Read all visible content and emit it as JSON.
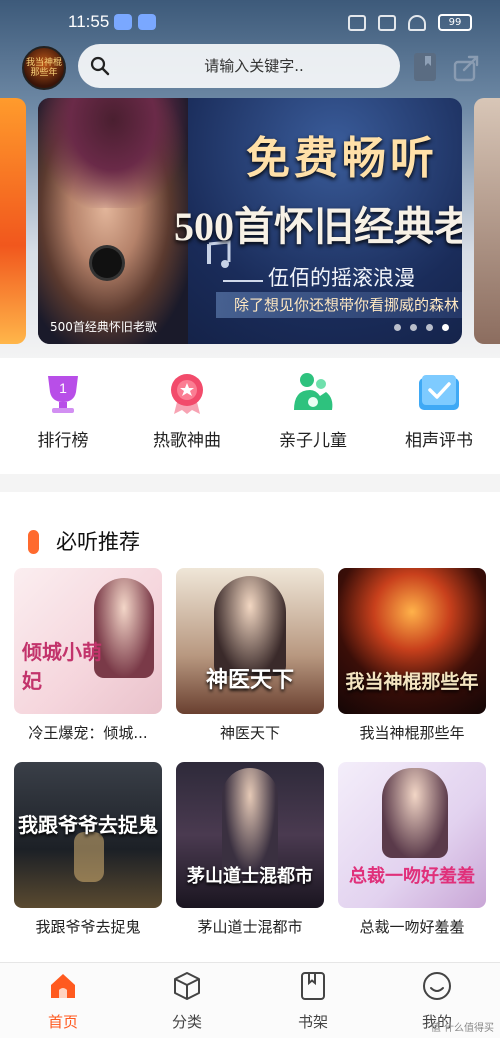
{
  "status_bar": {
    "time": "11:55",
    "battery": "99"
  },
  "header": {
    "avatar_text": "我当神棍那些年",
    "search_placeholder": "请输入关键字.."
  },
  "banner": {
    "title_line1": "免费畅听",
    "title_line2": "500首怀旧经典老",
    "subtitle": "伍佰的摇滚浪漫",
    "lyric": "除了想见你还想带你看挪威的森林",
    "caption": "500首经典怀旧老歌",
    "dot_count": 4,
    "active_dot": 3
  },
  "categories": [
    {
      "label": "排行榜",
      "icon": "trophy-icon",
      "color": "#b84ee8"
    },
    {
      "label": "热歌神曲",
      "icon": "medal-icon",
      "color": "#f24b6b"
    },
    {
      "label": "亲子儿童",
      "icon": "parent-child-icon",
      "color": "#2ec27e"
    },
    {
      "label": "相声评书",
      "icon": "book-check-icon",
      "color": "#3fa9f5"
    }
  ],
  "recommend": {
    "title": "必听推荐",
    "books": [
      {
        "title": "冷王爆宠：倾城...",
        "cover_text": "倾城小萌妃"
      },
      {
        "title": "神医天下",
        "cover_text": "神医天下"
      },
      {
        "title": "我当神棍那些年",
        "cover_text": "我当神棍那些年"
      },
      {
        "title": "我跟爷爷去捉鬼",
        "cover_text": "我跟爷爷去捉鬼"
      },
      {
        "title": "茅山道士混都市",
        "cover_text": "茅山道士混都市"
      },
      {
        "title": "总裁一吻好羞羞",
        "cover_text": "总裁一吻好羞羞"
      }
    ]
  },
  "nav": [
    {
      "label": "首页",
      "icon": "home-icon",
      "active": true
    },
    {
      "label": "分类",
      "icon": "cube-icon",
      "active": false
    },
    {
      "label": "书架",
      "icon": "bookshelf-icon",
      "active": false
    },
    {
      "label": "我的",
      "icon": "profile-icon",
      "active": false
    }
  ],
  "watermark": "值 什么值得买",
  "colors": {
    "accent": "#ff5a1f",
    "section_bar": "#ff6a2e"
  }
}
